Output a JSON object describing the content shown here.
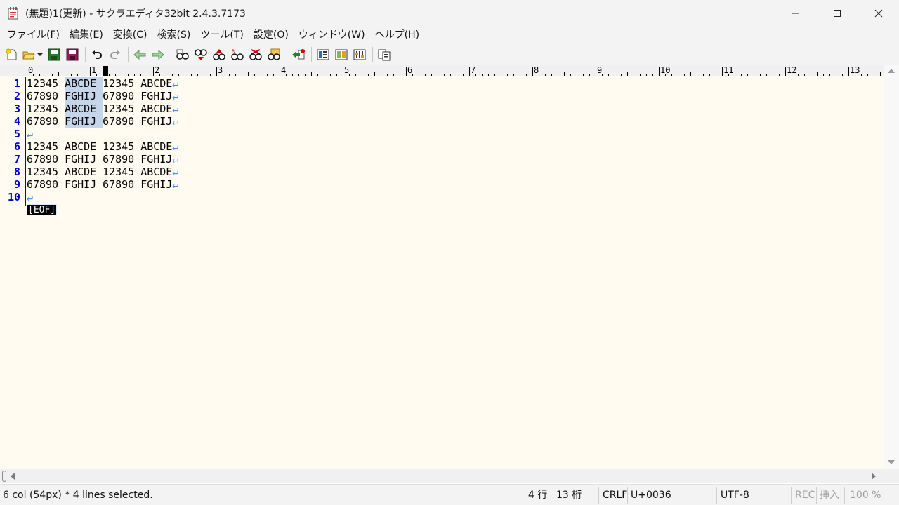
{
  "window": {
    "title": "(無題)1(更新) - サクラエディタ32bit 2.4.3.7173",
    "minimize_icon": "minimize-icon",
    "maximize_icon": "maximize-icon",
    "close_icon": "close-icon"
  },
  "menu": [
    {
      "label": "ファイル(",
      "key": "F",
      "tail": ")"
    },
    {
      "label": "編集(",
      "key": "E",
      "tail": ")"
    },
    {
      "label": "変換(",
      "key": "C",
      "tail": ")"
    },
    {
      "label": "検索(",
      "key": "S",
      "tail": ")"
    },
    {
      "label": "ツール(",
      "key": "T",
      "tail": ")"
    },
    {
      "label": "設定(",
      "key": "O",
      "tail": ")"
    },
    {
      "label": "ウィンドウ(",
      "key": "W",
      "tail": ")"
    },
    {
      "label": "ヘルプ(",
      "key": "H",
      "tail": ")"
    }
  ],
  "toolbar": [
    "new-file-icon",
    "open-file-icon",
    "open-dropdown-icon",
    "save-icon",
    "save-all-icon",
    "undo-icon",
    "redo-icon",
    "jump-back-icon",
    "jump-forward-icon",
    "search-icon",
    "search-next-icon",
    "search-prev-icon",
    "replace-icon",
    "clear-highlight-icon",
    "grep-icon",
    "tag-jump-icon",
    "outline-icon",
    "compare-icon",
    "settings-icon",
    "window-list-icon"
  ],
  "ruler": {
    "labels": [
      "0",
      "1",
      "2",
      "3",
      "4",
      "5",
      "6",
      "7",
      "8",
      "9",
      "10",
      "11",
      "12",
      "13"
    ]
  },
  "editor": {
    "line_numbers": [
      "1",
      "2",
      "3",
      "4",
      "5",
      "6",
      "7",
      "8",
      "9",
      "10"
    ],
    "lines": [
      "12345 ABCDE 12345 ABCDE",
      "67890 FGHIJ 67890 FGHIJ",
      "12345 ABCDE 12345 ABCDE",
      "67890 FGHIJ 67890 FGHIJ",
      "",
      "12345 ABCDE 12345 ABCDE",
      "67890 FGHIJ 67890 FGHIJ",
      "12345 ABCDE 12345 ABCDE",
      "67890 FGHIJ 67890 FGHIJ",
      ""
    ],
    "newline_mark": "↵",
    "eof_mark": "[EOF]",
    "colors": {
      "background": "#fffbf0",
      "line_number": "#0000c8",
      "selection": "#c5d6ea",
      "newline": "#4a90e2"
    }
  },
  "status": {
    "message": "6 col (54px) * 4 lines selected.",
    "row": "4 行",
    "col": "13 桁",
    "eol": "CRLF",
    "codepoint": "U+0036",
    "encoding": "UTF-8",
    "rec": "REC",
    "insert": "挿入",
    "zoom": "100 %"
  }
}
